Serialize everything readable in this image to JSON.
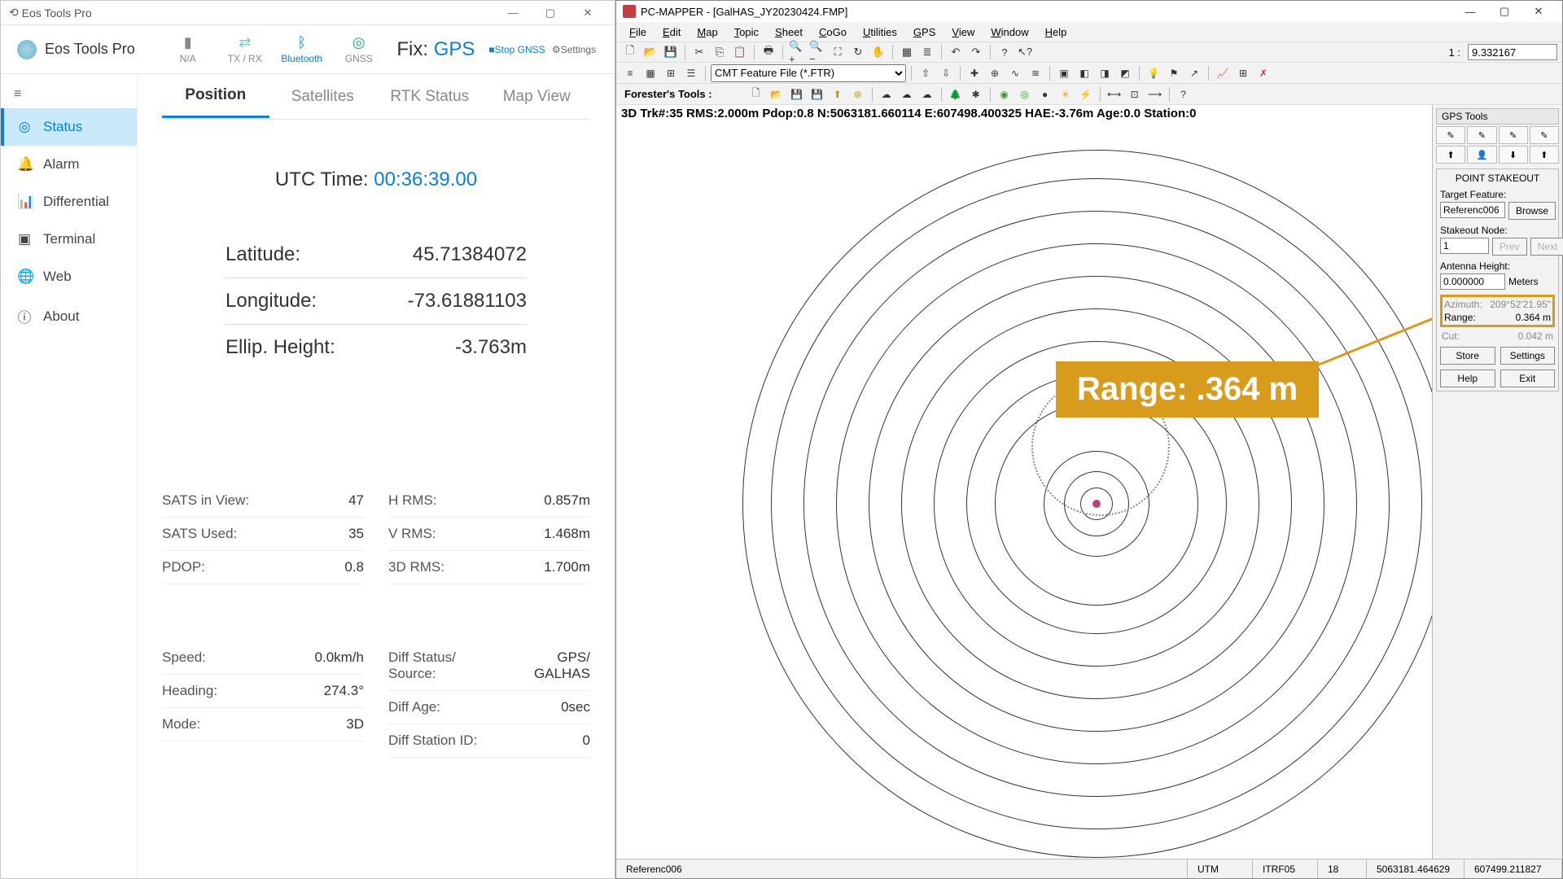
{
  "eos": {
    "title": "Eos Tools Pro",
    "brand": "Eos Tools Pro",
    "tools": {
      "na": "N/A",
      "txrx": "TX / RX",
      "bt": "Bluetooth",
      "gnss": "GNSS",
      "stop": "Stop GNSS",
      "settings": "Settings"
    },
    "fix_label": "Fix:",
    "fix_value": "GPS",
    "nav": {
      "status": "Status",
      "alarm": "Alarm",
      "diff": "Differential",
      "term": "Terminal",
      "web": "Web",
      "about": "About"
    },
    "tabs": {
      "position": "Position",
      "sats": "Satellites",
      "rtk": "RTK Status",
      "map": "Map View"
    },
    "utc_label": "UTC Time:",
    "utc_value": "00:36:39.00",
    "coords": {
      "lat_l": "Latitude:",
      "lat_v": "45.71384072",
      "lon_l": "Longitude:",
      "lon_v": "-73.61881103",
      "eh_l": "Ellip. Height:",
      "eh_v": "-3.763m"
    },
    "stats": {
      "siv_l": "SATS in View:",
      "siv_v": "47",
      "su_l": "SATS Used:",
      "su_v": "35",
      "pdop_l": "PDOP:",
      "pdop_v": "0.8",
      "hr_l": "H RMS:",
      "hr_v": "0.857m",
      "vr_l": "V RMS:",
      "vr_v": "1.468m",
      "r3_l": "3D RMS:",
      "r3_v": "1.700m"
    },
    "stats2": {
      "sp_l": "Speed:",
      "sp_v": "0.0km/h",
      "hd_l": "Heading:",
      "hd_v": "274.3°",
      "md_l": "Mode:",
      "md_v": "3D",
      "ds_l": "Diff Status/\nSource:",
      "ds_v": "GPS/\nGALHAS",
      "da_l": "Diff Age:",
      "da_v": "0sec",
      "di_l": "Diff Station ID:",
      "di_v": "0"
    }
  },
  "pcm": {
    "title": "PC-MAPPER - [GalHAS_JY20230424.FMP]",
    "menu": [
      "File",
      "Edit",
      "Map",
      "Topic",
      "Sheet",
      "CoGo",
      "Utilities",
      "GPS",
      "View",
      "Window",
      "Help"
    ],
    "ratio_label": "1 :",
    "ratio_value": "9.332167",
    "feature_select": "CMT Feature File (*.FTR)",
    "foresters": "Forester's Tools :",
    "track": "3D Trk#:35  RMS:2.000m  Pdop:0.8  N:5063181.660114  E:607498.400325  HAE:-3.76m  Age:0.0  Station:0",
    "callout": "Range: .364 m",
    "gps_tools_hdr": "GPS Tools",
    "stakeout": {
      "hdr": "POINT STAKEOUT",
      "tf_l": "Target Feature:",
      "tf_v": "Referenc006",
      "browse": "Browse",
      "sn_l": "Stakeout Node:",
      "sn_v": "1",
      "prev": "Prev",
      "next": "Next",
      "ah_l": "Antenna Height:",
      "ah_v": "0.000000",
      "ah_u": "Meters",
      "az_l": "Azimuth:",
      "az_v": "209°52'21.95\"",
      "rg_l": "Range:",
      "rg_v": "0.364 m",
      "cut_l": "Cut:",
      "cut_v": "0.042 m",
      "store": "Store",
      "settings": "Settings",
      "help": "Help",
      "exit": "Exit"
    },
    "status": {
      "ref": "Referenc006",
      "proj": "UTM",
      "datum": "ITRF05",
      "zone": "18",
      "n": "5063181.464629",
      "e": "607499.211827"
    }
  }
}
